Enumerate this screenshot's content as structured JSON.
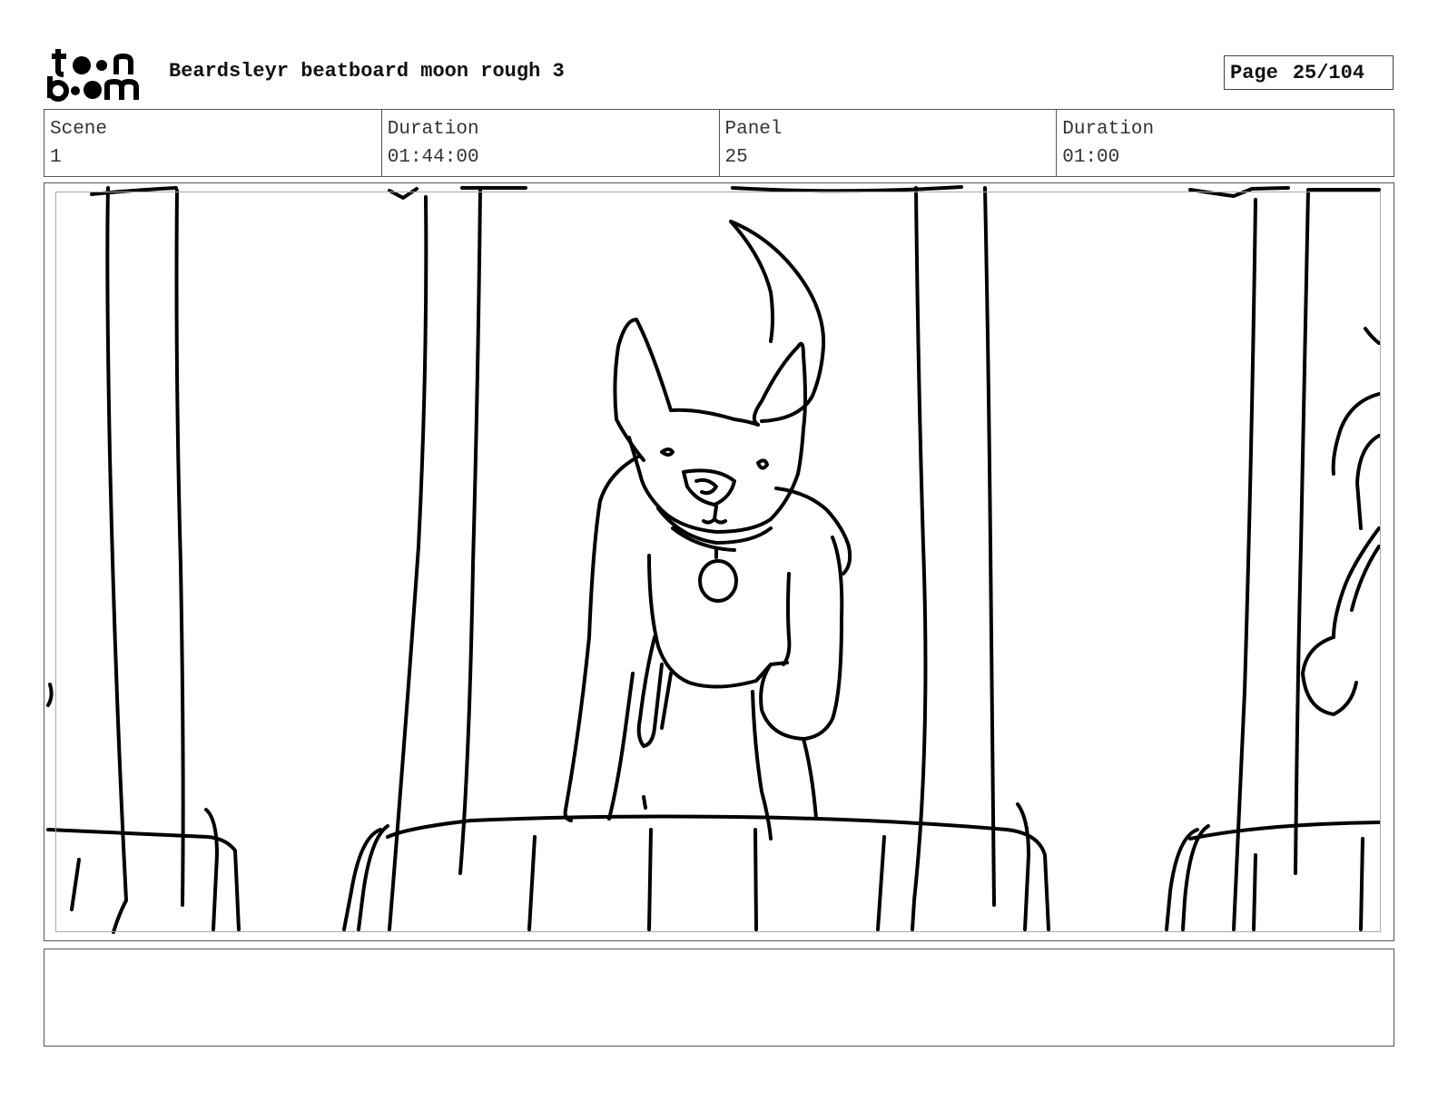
{
  "header": {
    "logo_text_top": "toon",
    "logo_text_bottom": "boom",
    "title": "Beardsleyr beatboard moon rough 3",
    "page_label": "Page",
    "page_number": "25/104"
  },
  "info": {
    "scene_label": "Scene",
    "scene_value": "1",
    "duration_label": "Duration",
    "duration_value": "01:44:00",
    "panel_label": "Panel",
    "panel_value": "25",
    "panel_duration_label": "Duration",
    "panel_duration_value": "01:00"
  },
  "panel_image": {
    "icon": "storyboard-sketch",
    "line_color": "#000000"
  },
  "notes": {
    "text": ""
  }
}
